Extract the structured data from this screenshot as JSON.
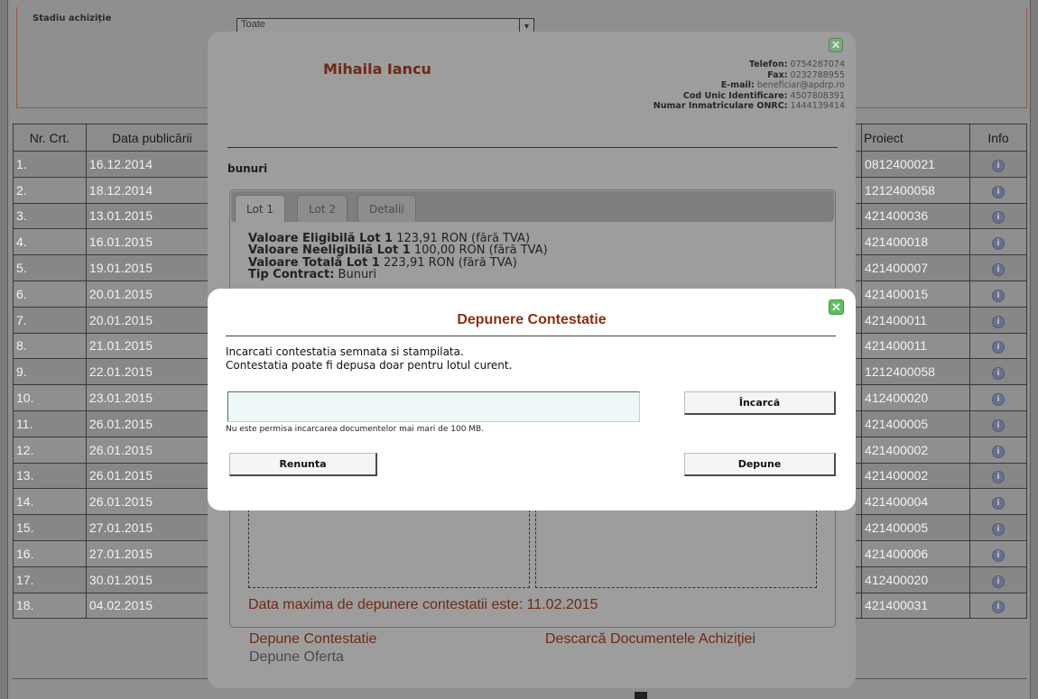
{
  "background": {
    "filter": {
      "label": "Stadiu achiziție",
      "select_value": "Toate"
    },
    "table": {
      "headers": [
        "Nr. Crt.",
        "Data publicării",
        "Proiect",
        "Info"
      ],
      "rows": [
        {
          "nr": "1.",
          "date": "16.12.2014",
          "proiect": "0812400021"
        },
        {
          "nr": "2.",
          "date": "18.12.2014",
          "proiect": "1212400058"
        },
        {
          "nr": "3.",
          "date": "13.01.2015",
          "proiect": "421400036"
        },
        {
          "nr": "4.",
          "date": "16.01.2015",
          "proiect": "421400018"
        },
        {
          "nr": "5.",
          "date": "19.01.2015",
          "proiect": "421400007"
        },
        {
          "nr": "6.",
          "date": "20.01.2015",
          "proiect": "421400015"
        },
        {
          "nr": "7.",
          "date": "20.01.2015",
          "proiect": "421400011"
        },
        {
          "nr": "8.",
          "date": "21.01.2015",
          "proiect": "421400011"
        },
        {
          "nr": "9.",
          "date": "22.01.2015",
          "proiect": "1212400058"
        },
        {
          "nr": "10.",
          "date": "23.01.2015",
          "proiect": "412400020"
        },
        {
          "nr": "11.",
          "date": "26.01.2015",
          "proiect": "421400005"
        },
        {
          "nr": "12.",
          "date": "26.01.2015",
          "proiect": "421400002"
        },
        {
          "nr": "13.",
          "date": "26.01.2015",
          "proiect": "421400002"
        },
        {
          "nr": "14.",
          "date": "26.01.2015",
          "proiect": "421400004"
        },
        {
          "nr": "15.",
          "date": "27.01.2015",
          "proiect": "421400005"
        },
        {
          "nr": "16.",
          "date": "27.01.2015",
          "proiect": "421400006"
        },
        {
          "nr": "17.",
          "date": "30.01.2015",
          "proiect": "412400020"
        },
        {
          "nr": "18.",
          "date": "04.02.2015",
          "proiect": "421400031"
        }
      ]
    }
  },
  "detail_modal": {
    "name": "Mihaila Iancu",
    "contact": [
      {
        "label": "Telefon:",
        "value": "0754287074"
      },
      {
        "label": "Fax:",
        "value": "0232788955"
      },
      {
        "label": "E-mail:",
        "value": "beneficiar@apdrp.ro"
      },
      {
        "label": "Cod Unic Identificare:",
        "value": "4507808391"
      },
      {
        "label": "Numar Inmatriculare ONRC:",
        "value": "1444139414"
      }
    ],
    "category": "bunuri",
    "tabs": [
      "Lot 1",
      "Lot 2",
      "Detalii"
    ],
    "lot_lines": [
      {
        "label": "Valoare Eligibilă Lot 1",
        "value": "123,91 RON (fără TVA)"
      },
      {
        "label": "Valoare Neeligibilă Lot 1",
        "value": "100,00 RON (fără TVA)"
      },
      {
        "label": "Valoare Totală Lot 1",
        "value": "223,91 RON (fără TVA)"
      },
      {
        "label": "Tip Contract:",
        "value": "Bunuri"
      }
    ],
    "deadline": "Data maxima de depunere contestatii este: 11.02.2015",
    "links": {
      "contestatie": "Depune Contestatie",
      "descarca": "Descarcă Documentele Achiziţiei",
      "oferta": "Depune Oferta"
    }
  },
  "contest_dialog": {
    "title": "Depunere Contestatie",
    "instructions": [
      "Incarcati contestatia semnata si stampilata.",
      "Contestatia poate fi depusa doar pentru lotul curent."
    ],
    "file_input_value": "",
    "upload_button": "Încarcă",
    "size_note": "Nu este permisa incarcarea documentelor mai mari de 100 MB.",
    "cancel_button": "Renunta",
    "submit_button": "Depune"
  }
}
